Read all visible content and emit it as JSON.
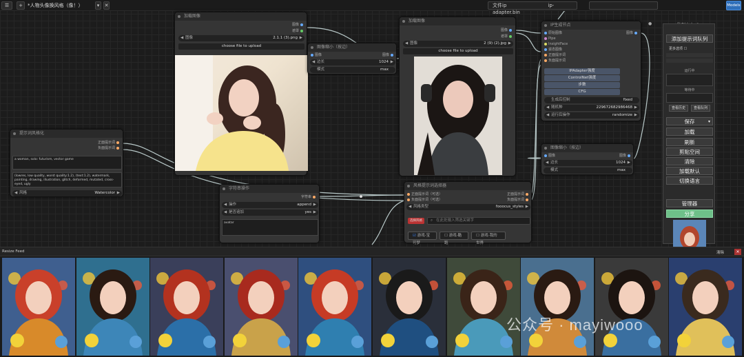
{
  "topbar": {
    "title": "*人物头像换风格（像！）",
    "plus": "+",
    "models_button": "Models",
    "file_label": "文件ip",
    "file_value": "ip-adapter.bin"
  },
  "nodes": {
    "load_image_1": {
      "title": "加载图像",
      "out_image": "图像",
      "out_mask": "遮罩",
      "image_label": "图像",
      "image_value": "2.1.1 (3).png",
      "upload": "choose file to upload"
    },
    "scale_image_1": {
      "title": "图像缩小（按边）",
      "out_image": "图像",
      "in_image": "图像",
      "side_label": "边长",
      "side_value": "1024",
      "mode_label": "模式",
      "mode_value": "max"
    },
    "load_image_2": {
      "title": "加载图像",
      "out_image": "图像",
      "out_mask": "遮罩",
      "image_label": "图像",
      "image_value": "2 (9) (2).jpg",
      "upload": "choose file to upload"
    },
    "ip_node": {
      "title": "IP生成节点",
      "ports_in": [
        "原始图像",
        "Pipe",
        "InsightFace",
        "姿态图像",
        "正面提示词",
        "负面提示词"
      ],
      "out_image": "图像",
      "bar1": "IPAdapter强度",
      "bar2": "ControlNet强度",
      "bar3": "步数",
      "bar4": "CFG",
      "seed_mode_label": "生成后控制",
      "seed_mode_value": "fixed",
      "seed_label": "随机种",
      "seed_value": "229672682986468",
      "action_label": "运行后操作",
      "action_value": "randomize"
    },
    "scale_image_2": {
      "title": "图像缩小（按边）",
      "out_image": "图像",
      "in_image": "图像",
      "side_label": "边长",
      "side_value": "1024",
      "mode_label": "模式",
      "mode_value": "max"
    },
    "prompt_style": {
      "title": "提示词风格化",
      "out_pos": "正面提示词",
      "out_neg": "负面提示词",
      "pos_text": "a woman, solo: futurism, vector game",
      "neg_text": "(lowres, low quality, worst quality:1.2), (text:1.2), watermark, painting, drawing, illustration, glitch, deformed, mutated, cross-eyed, ugly",
      "style_label": "风格",
      "style_value": "Watercolor"
    },
    "string_op": {
      "title": "字符串操作",
      "out_str": "字符串",
      "op_label": "操作",
      "op_value": "append",
      "suffix_label": "是否追加",
      "suffix_value": "yes",
      "text_value": "avatar"
    },
    "style_selector": {
      "title": "风格提示词选择器",
      "in_pos": "正面提示词（可选）",
      "in_neg": "负面提示词（可选）",
      "out_pos": "正面提示词",
      "out_neg": "负面提示词",
      "type_label": "风格类型",
      "type_value": "fooocus_styles",
      "tag": "选择风格",
      "search_placeholder": "在此处输入筛选关键字",
      "chk1": "游戏-宝可梦",
      "chk2": "游戏-酷跑",
      "chk3": "游戏-我的世界"
    }
  },
  "panel": {
    "title": "队列大小: 0",
    "queue_button": "添加提示词队列",
    "extra_label": "更多选项",
    "running": "运行中",
    "pending": "等待中",
    "view_history": "查看历史",
    "view_queue": "查看队列",
    "buttons": [
      "保存",
      "加载",
      "刷新",
      "剪贴空间",
      "清除",
      "加载默认",
      "切换语言"
    ],
    "manager": "管理器",
    "share": "分享"
  },
  "gallery": {
    "title": "Resize Feed",
    "close_label": "清除",
    "thumb_count": 10
  },
  "watermark": {
    "text": "公众号 · mayiwooo"
  }
}
